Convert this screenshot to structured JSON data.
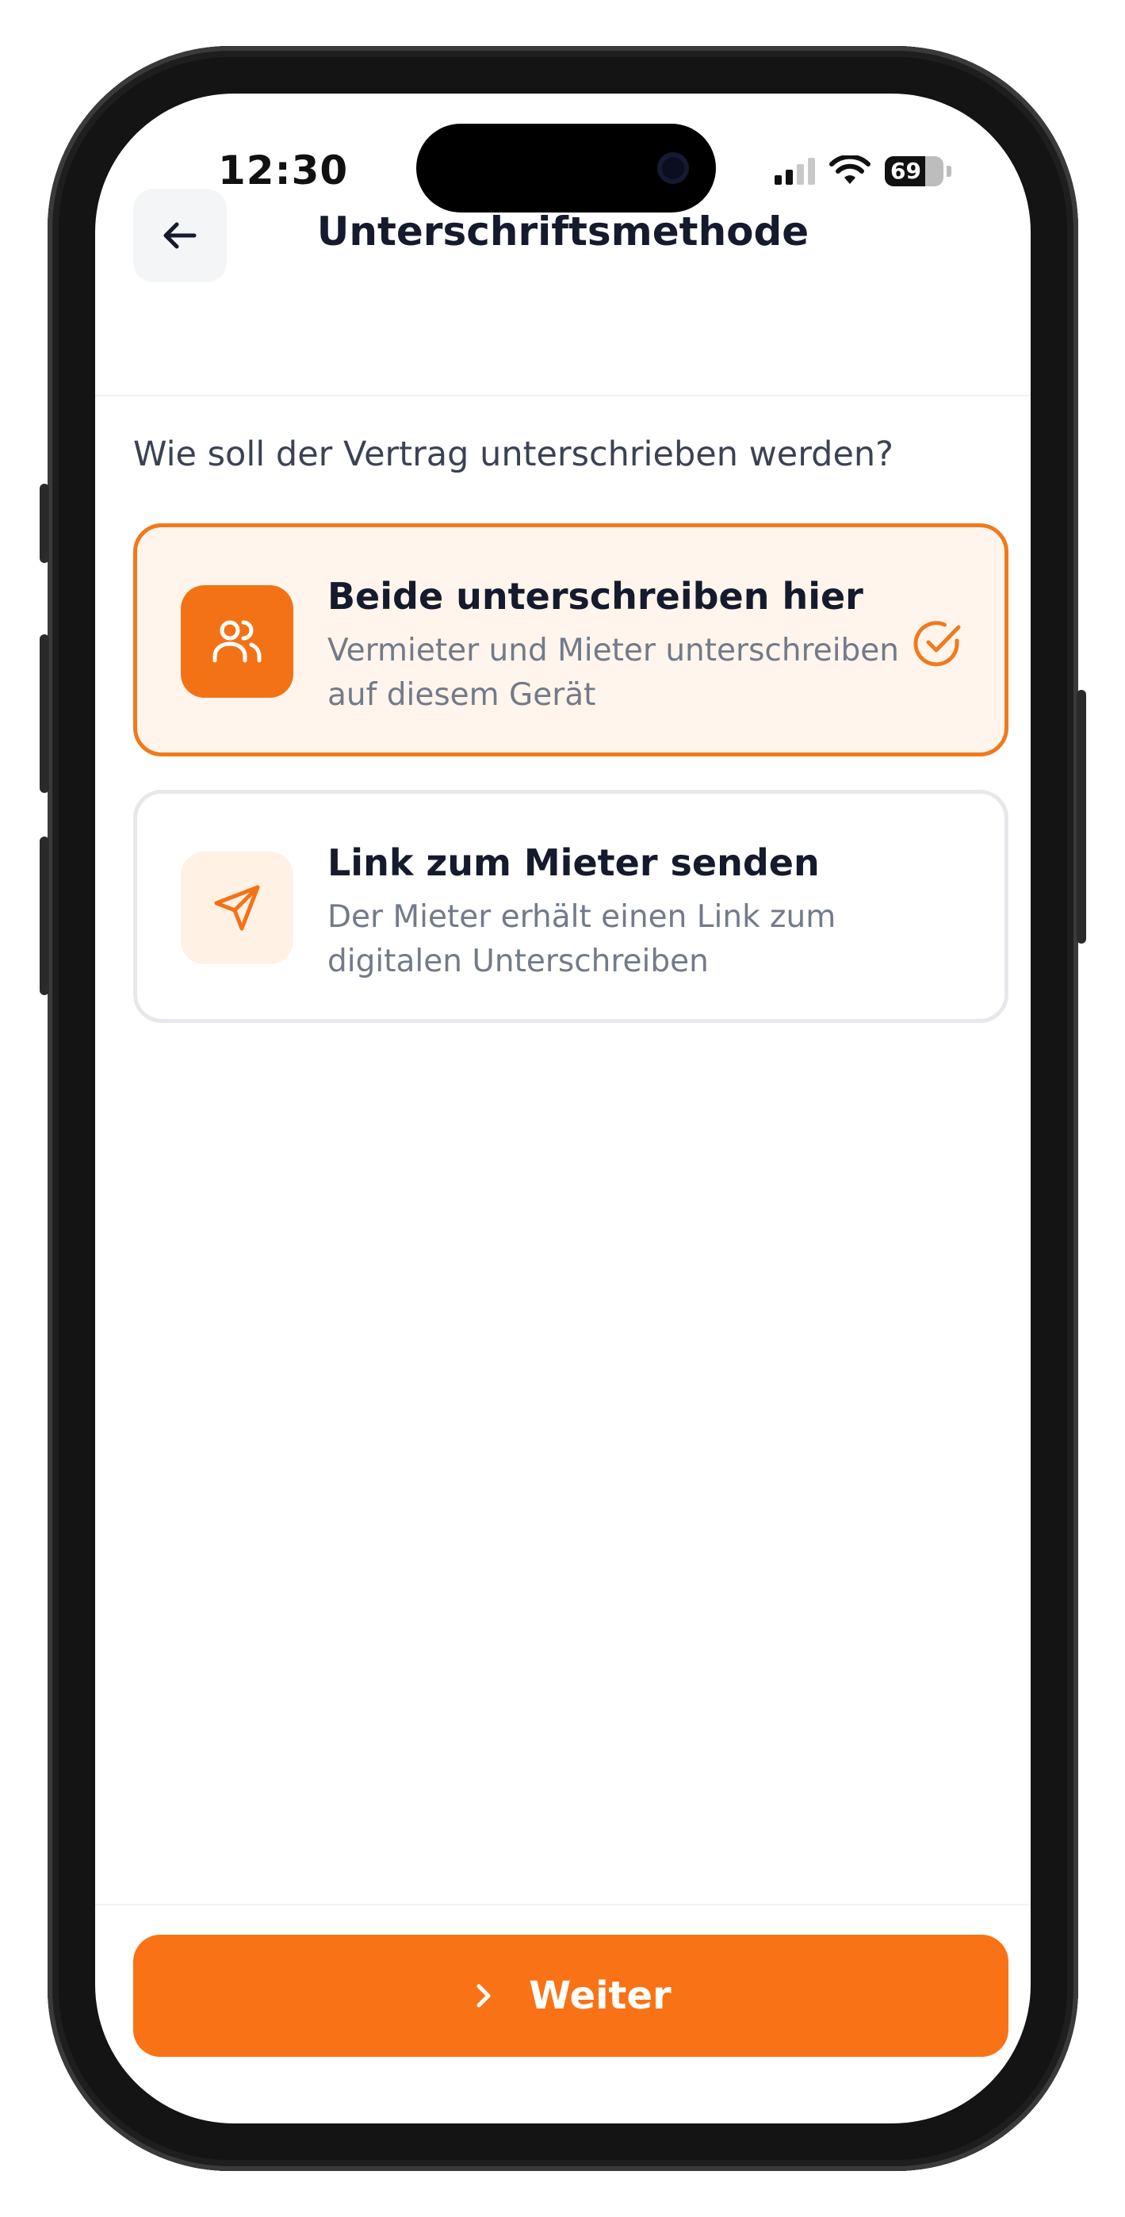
{
  "status_bar": {
    "time": "12:30",
    "battery": "69",
    "battery_level": 0.69
  },
  "header": {
    "title": "Unterschriftsmethode",
    "back_icon": "arrow-left-icon"
  },
  "question": "Wie soll der Vertrag unterschrieben werden?",
  "options": [
    {
      "title": "Beide unterschreiben hier",
      "description": "Vermieter und Mieter unterschreiben auf diesem Gerät",
      "icon": "users-icon",
      "selected": true
    },
    {
      "title": "Link zum Mieter senden",
      "description": "Der Mieter erhält einen Link zum digitalen Unterschreiben",
      "icon": "send-icon",
      "selected": false
    }
  ],
  "cta": {
    "label": "Weiter",
    "icon": "chevron-right-icon"
  },
  "colors": {
    "accent": "#f97316",
    "selected_bg": "#fff5ec",
    "text_primary": "#151a2d",
    "text_secondary": "#737a89"
  }
}
